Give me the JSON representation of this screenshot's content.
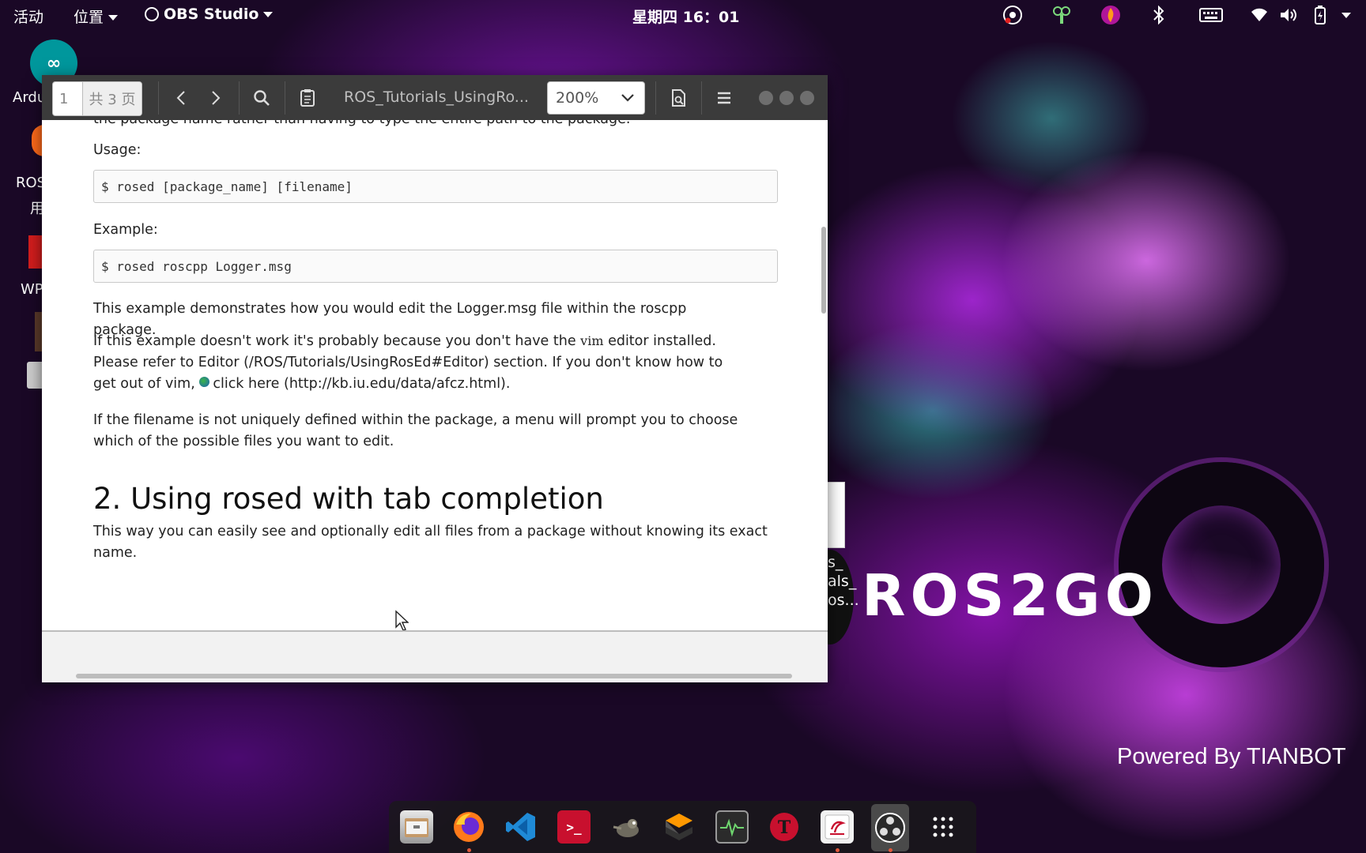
{
  "topbar": {
    "activities": "活动",
    "places": "位置",
    "app_name": "OBS Studio",
    "clock": "星期四 16：01"
  },
  "desktop": {
    "icons": [
      {
        "label": "Ardu"
      },
      {
        "label": "ROS"
      },
      {
        "label": "用"
      },
      {
        "label": "WP"
      }
    ],
    "side_thumb_label": "s_\nals_\nos...",
    "brand": "ROS2GO",
    "powered_by": "Powered By TIANBOT"
  },
  "viewer": {
    "page_current": "1",
    "page_total": "共 3 页",
    "document_title": "ROS_Tutorials_UsingRo...",
    "zoom": "200%",
    "content": {
      "cut_line": "the package name rather than having to type the entire path to the package.",
      "usage_label": "Usage:",
      "usage_code": "$ rosed [package_name] [filename]",
      "example_label": "Example:",
      "example_code": "$ rosed roscpp Logger.msg",
      "para1": "This example demonstrates how you would edit the Logger.msg file within the roscpp package.",
      "para2_a": "If this example doesn't work it's probably because you don't have the ",
      "para2_code": "vim",
      "para2_b": " editor installed. Please refer to Editor (/ROS/Tutorials/UsingRosEd#Editor) section. If you don't know how to get out of vim, ",
      "para2_link": "click here (http://kb.iu.edu/data/afcz.html).",
      "para3": "If the filename is not uniquely defined within the package, a menu will prompt you to choose which of the possible files you want to edit.",
      "heading": "2. Using rosed with tab completion",
      "para4": "This way you can easily see and optionally edit all files from a package without knowing its exact name."
    }
  },
  "dock": {
    "apps": [
      "file-manager",
      "firefox",
      "vscode",
      "terminal",
      "gimp",
      "sublime",
      "system-monitor",
      "typora",
      "fcitx",
      "obs-studio",
      "show-apps"
    ]
  },
  "colors": {
    "window_header": "#3b3b3b",
    "wallpaper_base": "#1a0826",
    "accent_purple": "#a020d0"
  }
}
